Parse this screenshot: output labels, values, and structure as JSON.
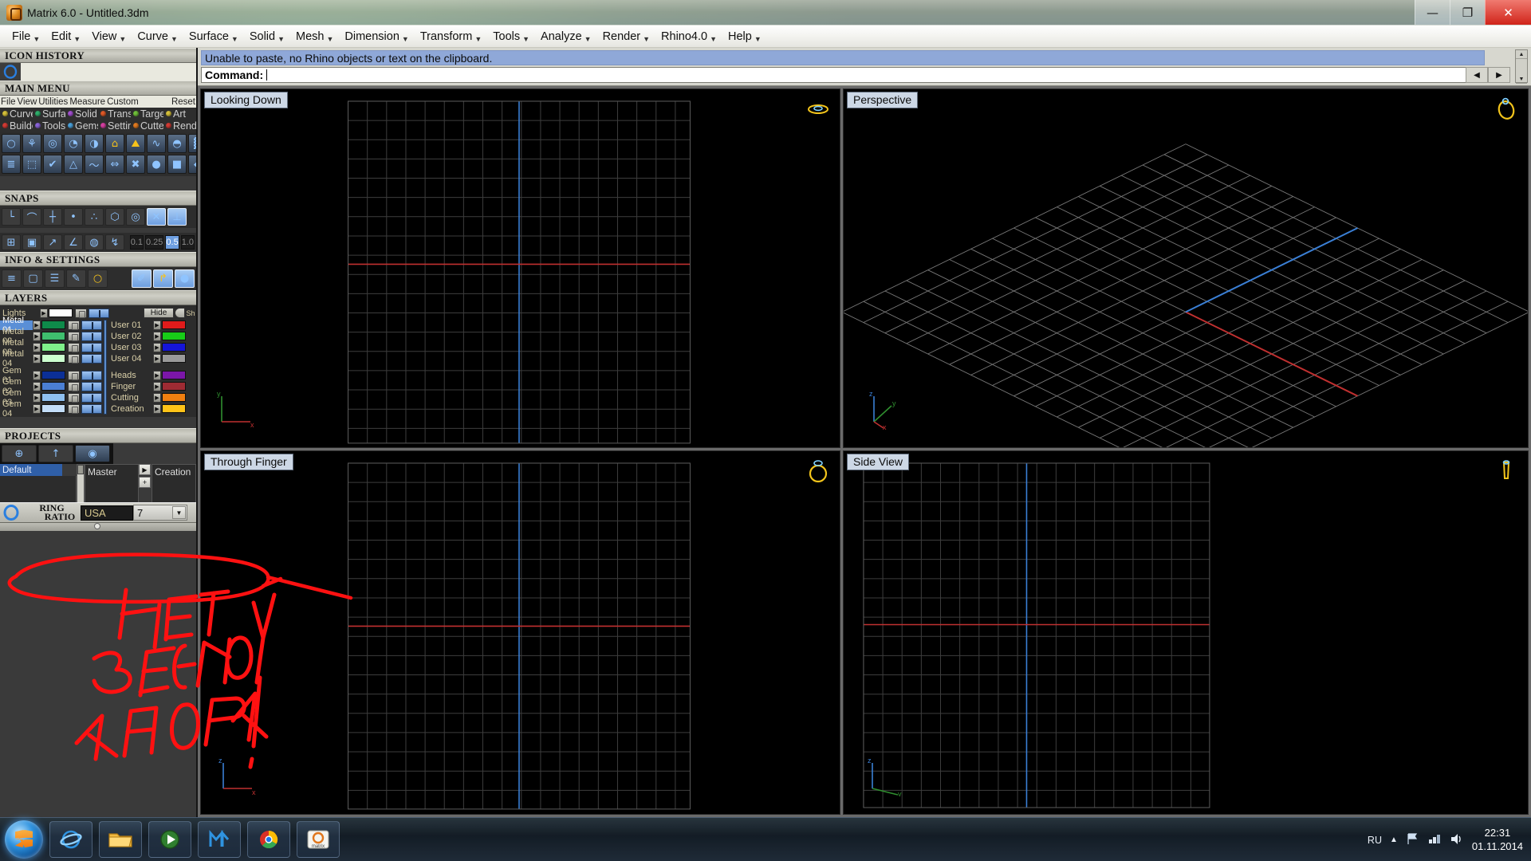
{
  "window": {
    "title": "Matrix 6.0 - Untitled.3dm",
    "app_icon": "matrix-logo-icon",
    "controls": {
      "minimize": "—",
      "maximize": "❐",
      "close": "✕"
    }
  },
  "menubar": {
    "items": [
      "File",
      "Edit",
      "View",
      "Curve",
      "Surface",
      "Solid",
      "Mesh",
      "Dimension",
      "Transform",
      "Tools",
      "Analyze",
      "Render",
      "Rhino4.0",
      "Help"
    ]
  },
  "sidebar": {
    "sections": [
      {
        "title": "ICON HISTORY"
      },
      {
        "title": "MAIN MENU"
      },
      {
        "title": "SNAPS"
      },
      {
        "title": "INFO & SETTINGS"
      },
      {
        "title": "LAYERS"
      },
      {
        "title": "PROJECTS"
      }
    ],
    "main_menu": {
      "top_row": [
        "File",
        "View",
        "Utilities",
        "Measure",
        "Custom",
        "Reset"
      ],
      "categories_row1": [
        {
          "label": "Curve",
          "color": "#d6c13a"
        },
        {
          "label": "Surface",
          "color": "#2fae6b"
        },
        {
          "label": "Solid",
          "color": "#a14fd0"
        },
        {
          "label": "Transform",
          "color": "#e05a28"
        },
        {
          "label": "Target",
          "color": "#6fbf3a"
        },
        {
          "label": "Art",
          "color": "#d6c13a"
        }
      ],
      "categories_row2": [
        {
          "label": "Builder",
          "color": "#d23b34"
        },
        {
          "label": "Tools",
          "color": "#8a64d8"
        },
        {
          "label": "Gems",
          "color": "#4a9fd8"
        },
        {
          "label": "Settings",
          "color": "#d43fa0"
        },
        {
          "label": "Cutters",
          "color": "#e07a20"
        },
        {
          "label": "Render",
          "color": "#d23b34"
        }
      ],
      "tool_icons_row1": [
        "ring-icon",
        "prong-icon",
        "bezel-icon",
        "shank-icon",
        "shank-edit-icon",
        "dome-icon",
        "dome-gold-icon",
        "curve-sweep-icon",
        "signet-ring-icon",
        "texture-icon"
      ],
      "tool_icons_row2": [
        "layers-icon",
        "select-boundary-icon",
        "check-icon",
        "cone-icon",
        "curve-pair-icon",
        "mirror-icon",
        "mirror-delete-icon",
        "sphere-icon",
        "bucket-icon",
        "gem-icon"
      ]
    },
    "snaps": {
      "icons": [
        "snap-end-icon",
        "snap-near-icon",
        "snap-point-icon",
        "snap-mid-icon",
        "snap-center-line-icon",
        "snap-quad-icon",
        "snap-center-icon",
        "snap-intersect-icon",
        "snap-perp-icon"
      ],
      "tool_icons": [
        "grid-snap-icon",
        "ortho-icon",
        "planar-icon",
        "angle-45-icon",
        "smart-track-icon",
        "record-history-icon"
      ],
      "values": [
        "0.1",
        "0.25",
        "0.5",
        "1.0"
      ],
      "selected_value": "0.5"
    },
    "info_settings": {
      "icons": [
        "stack-icon",
        "box-icon",
        "document-icon",
        "edit-icon",
        "ring-gold-icon",
        "brush-icon",
        "export-icon",
        "globe-icon"
      ]
    },
    "layers": {
      "header_row": {
        "name": "Lights",
        "hide_label": "Hide",
        "extra_label": "Sh"
      },
      "left_column": [
        {
          "name": "Metal 01",
          "color": "#0e8a4a",
          "selected": true
        },
        {
          "name": "Metal 02",
          "color": "#3fbf6e",
          "selected": false
        },
        {
          "name": "Metal 03",
          "color": "#7ff08a",
          "selected": false
        },
        {
          "name": "Metal 04",
          "color": "#ccffcf",
          "selected": false
        },
        {
          "name": "Gem 01",
          "color": "#0b2f96",
          "selected": false
        },
        {
          "name": "Gem 02",
          "color": "#4b7fd4",
          "selected": false
        },
        {
          "name": "Gem 03",
          "color": "#8fc0f0",
          "selected": false
        },
        {
          "name": "Gem 04",
          "color": "#c3ddf8",
          "selected": false
        }
      ],
      "right_column": [
        {
          "name": "User 01",
          "color": "#e01b1b"
        },
        {
          "name": "User 02",
          "color": "#18cc18"
        },
        {
          "name": "User 03",
          "color": "#1515d8"
        },
        {
          "name": "User 04",
          "color": "#9a9a9a"
        },
        {
          "name": "Heads",
          "color": "#7b16a8"
        },
        {
          "name": "Finger",
          "color": "#9e2b33"
        },
        {
          "name": "Cutting",
          "color": "#f07f10"
        },
        {
          "name": "Creation",
          "color": "#ffc318"
        }
      ]
    },
    "projects": {
      "buttons": [
        "new-folder-icon",
        "open-folder-icon",
        "gem-blue-icon"
      ],
      "list": [
        "Default"
      ],
      "selected": "Default",
      "columns": [
        "Master",
        "Creation"
      ]
    },
    "ring": {
      "label_line1": "RING",
      "label_line2": "RATIO",
      "standard": "USA",
      "size": "7",
      "dropdown_arrow": "▼",
      "icon": "ring-blue-icon"
    }
  },
  "command_area": {
    "history": "Unable to paste, no Rhino objects or text on the clipboard.",
    "prompt_label": "Command:",
    "prompt_value": "",
    "scroll_up": "▲",
    "scroll_down": "▼",
    "nav_prev": "◀",
    "nav_next": "▶"
  },
  "viewports": [
    {
      "label": "Looking Down",
      "icon": "ring-top-view-icon",
      "axes": [
        "y",
        "x"
      ],
      "axis_colors": [
        "#2f6f2f",
        "#b03030"
      ]
    },
    {
      "label": "Perspective",
      "icon": "ring-perspective-icon",
      "axes": [
        "z",
        "y",
        "x"
      ],
      "axis_colors": [
        "#3a7fd5",
        "#2f8f2f",
        "#c03030"
      ]
    },
    {
      "label": "Through Finger",
      "icon": "ring-front-view-icon",
      "axes": [
        "z",
        "x"
      ],
      "axis_colors": [
        "#3a7fd5",
        "#b03030"
      ]
    },
    {
      "label": "Side View",
      "icon": "ring-side-view-icon",
      "axes": [
        "z",
        "y"
      ],
      "axis_colors": [
        "#3a7fd5",
        "#2f8f2f"
      ]
    }
  ],
  "annotation": {
    "color": "#ff1111",
    "lines": [
      "НЕТ",
      "ЗЕЛЕНОЙ",
      "КНОПКИ"
    ],
    "exclamation": "!"
  },
  "taskbar": {
    "start_label": "start-orb",
    "buttons": [
      "internet-explorer-icon",
      "explorer-folder-icon",
      "media-player-icon",
      "mail-icon",
      "chrome-icon",
      "matrix-icon"
    ],
    "tray": {
      "language": "RU",
      "icons": [
        "show-hidden-icon",
        "flag-icon",
        "network-icon",
        "volume-icon"
      ],
      "time": "22:31",
      "date": "01.11.2014"
    }
  },
  "colors": {
    "accent_blue": "#5a8fd6",
    "panel_bg": "#3a3a3a",
    "viewport_bg": "#000000",
    "grid_line": "#3a3a3a",
    "axis_x": "#c03030",
    "axis_y": "#3a7fd5"
  }
}
